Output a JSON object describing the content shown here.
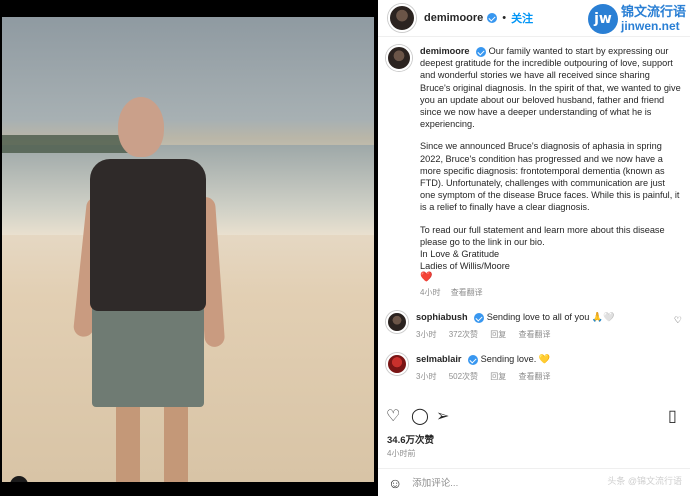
{
  "post": {
    "username": "demimoore",
    "follow_label": "关注",
    "dot": "•"
  },
  "logo": {
    "badge": "jw",
    "cn": "锦文流行语",
    "en": "jinwen.net"
  },
  "caption": {
    "username": "demimoore",
    "p1": "Our family wanted to start by expressing our deepest gratitude for the incredible outpouring of love, support and wonderful stories we have all received since sharing Bruce's original diagnosis. In the spirit of that, we wanted to give you an update about our beloved husband, father and friend since we now have a deeper understanding of what he is experiencing.",
    "p2": "Since we announced Bruce's diagnosis of aphasia in spring 2022, Bruce's condition has progressed and we now have a more specific diagnosis: frontotemporal dementia (known as FTD). Unfortunately, challenges with communication are just one symptom of the disease Bruce faces. While this is painful, it is a relief to finally have a clear diagnosis.",
    "p3": "To read our full statement and learn more about this disease please go to the link in our bio.",
    "p4": "In Love & Gratitude",
    "p5": "Ladies of Willis/Moore",
    "heart": "❤️",
    "time": "4小时",
    "translate": "查看翻译"
  },
  "comments": [
    {
      "username": "sophiabush",
      "text": "Sending love to all of you 🙏🤍",
      "time": "3小时",
      "likes": "372次赞",
      "reply": "回复",
      "translate": "查看翻译"
    },
    {
      "username": "selmablair",
      "text": "Sending love. 💛",
      "time": "3小时",
      "likes": "502次赞",
      "reply": "回复",
      "translate": "查看翻译"
    }
  ],
  "likes_count": "34.6万次赞",
  "post_date": "4小时前",
  "add_comment_placeholder": "添加评论...",
  "watermark": "头条 @锦文流行语"
}
